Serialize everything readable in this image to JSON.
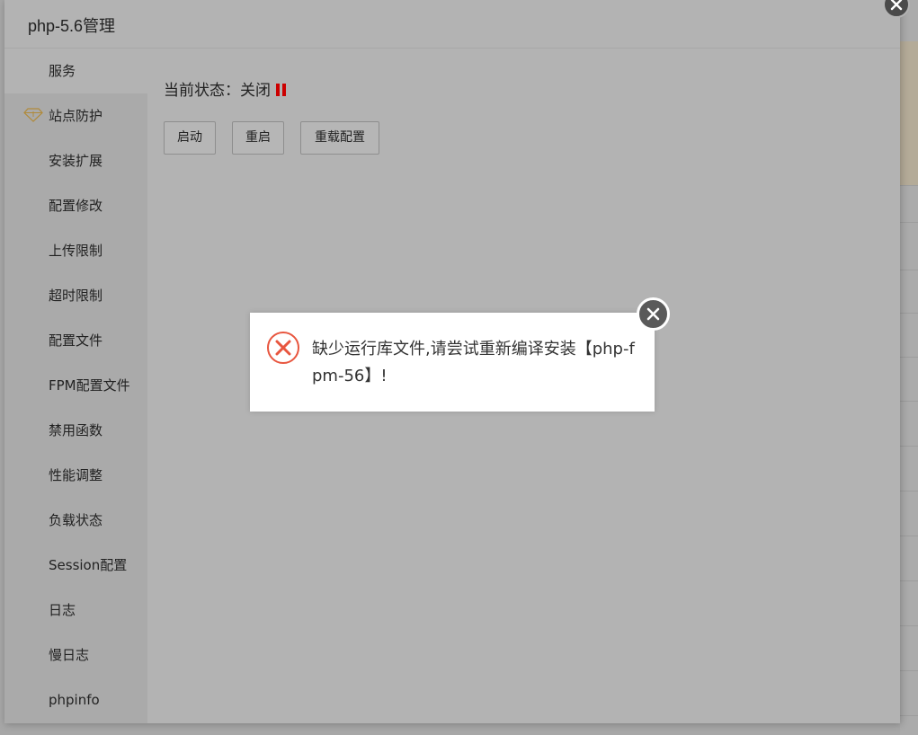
{
  "window": {
    "title": "php-5.6管理"
  },
  "sidebar": {
    "items": [
      {
        "label": "服务"
      },
      {
        "label": "站点防护"
      },
      {
        "label": "安装扩展"
      },
      {
        "label": "配置修改"
      },
      {
        "label": "上传限制"
      },
      {
        "label": "超时限制"
      },
      {
        "label": "配置文件"
      },
      {
        "label": "FPM配置文件"
      },
      {
        "label": "禁用函数"
      },
      {
        "label": "性能调整"
      },
      {
        "label": "负载状态"
      },
      {
        "label": "Session配置"
      },
      {
        "label": "日志"
      },
      {
        "label": "慢日志"
      },
      {
        "label": "phpinfo"
      }
    ],
    "active_index": 0
  },
  "service": {
    "status_label": "当前状态：",
    "status_value": "关闭",
    "status_color": "#cc0000",
    "buttons": {
      "start": "启动",
      "restart": "重启",
      "reload": "重载配置"
    }
  },
  "error_dialog": {
    "message": "缺少运行库文件,请尝试重新编译安装【php-fpm-56】!",
    "icon": "error-circle-x-icon",
    "icon_color": "#e8563f"
  },
  "colors": {
    "overlay": "#b3b3b3",
    "dialog_bg": "#ffffff"
  }
}
